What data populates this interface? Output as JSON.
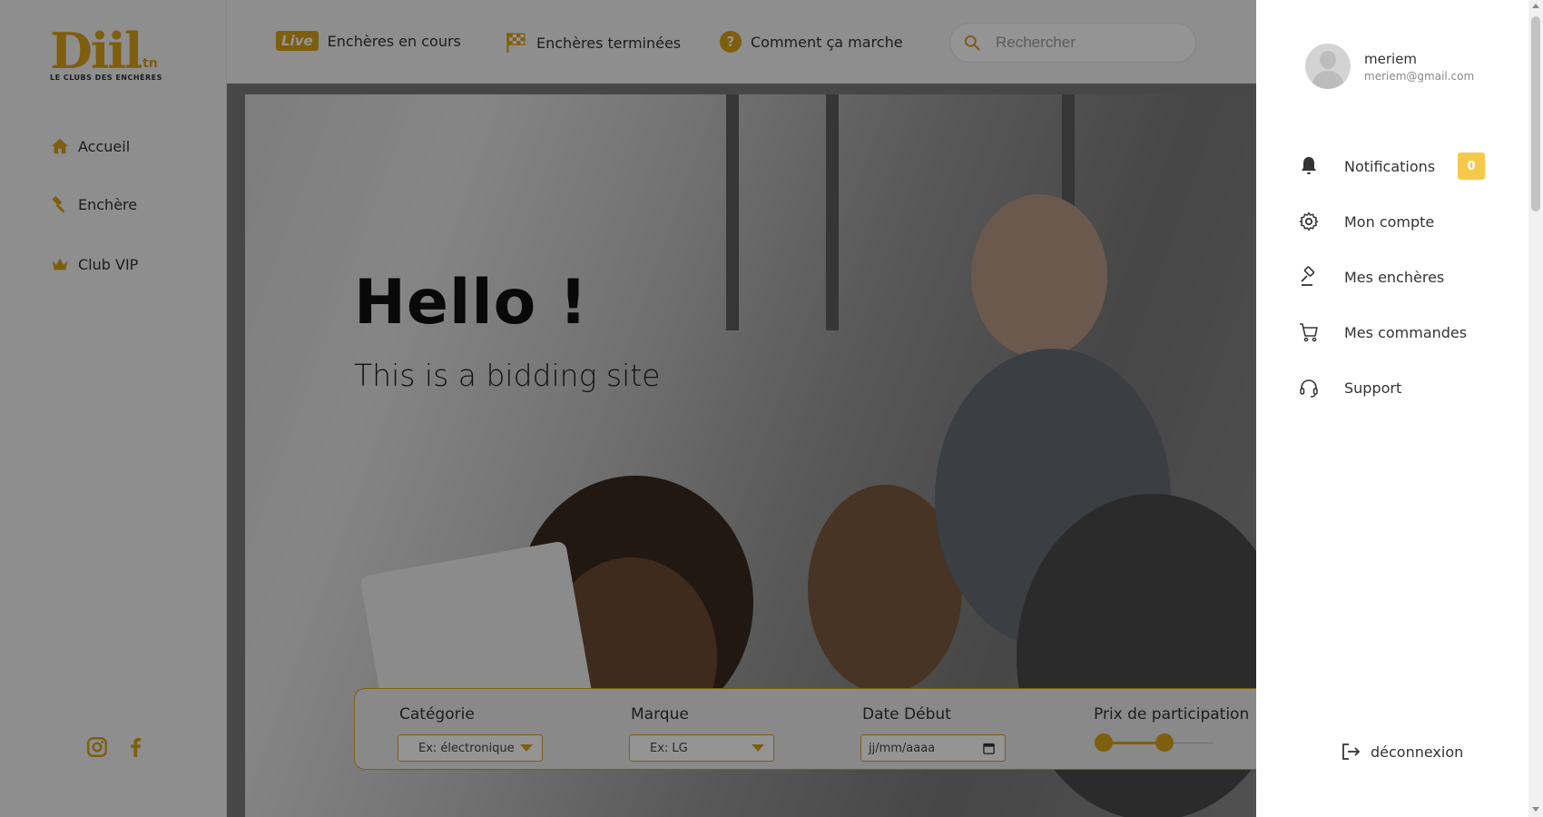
{
  "brand": {
    "logo_text": "Diil",
    "logo_suffix": "tn",
    "tagline": "LE CLUBS DES ENCHÈRES",
    "accent_color": "#d9a21a"
  },
  "sidebar": {
    "items": [
      {
        "label": "Accueil",
        "icon": "home-icon"
      },
      {
        "label": "Enchère",
        "icon": "gavel-icon"
      },
      {
        "label": "Club VIP",
        "icon": "crown-icon"
      }
    ],
    "socials": [
      "instagram-icon",
      "facebook-icon"
    ]
  },
  "topbar": {
    "live_badge": "Live",
    "links": [
      {
        "label": "Enchères en cours"
      },
      {
        "label": "Enchères terminées",
        "icon": "checkered-flag-icon"
      },
      {
        "label": "Comment ça marche",
        "icon": "question-icon",
        "icon_text": "?"
      }
    ],
    "search_placeholder": "Rechercher"
  },
  "hero": {
    "title": "Hello !",
    "subtitle": "This is a bidding site"
  },
  "filters": {
    "category_label": "Catégorie",
    "category_value": "Ex: électronique",
    "brand_label": "Marque",
    "brand_value": "Ex: LG",
    "date_label": "Date Début",
    "date_placeholder": "jj/mm/aaaa",
    "price_label": "Prix de participation"
  },
  "drawer": {
    "user_name": "meriem",
    "user_email": "meriem@gmail.com",
    "menu": [
      {
        "label": "Notifications",
        "icon": "bell-icon"
      },
      {
        "label": "Mon compte",
        "icon": "gear-icon"
      },
      {
        "label": "Mes enchères",
        "icon": "gavel-icon"
      },
      {
        "label": "Mes commandes",
        "icon": "cart-icon"
      },
      {
        "label": "Support",
        "icon": "headset-icon"
      }
    ],
    "notification_count": "0",
    "logout_label": "déconnexion"
  }
}
